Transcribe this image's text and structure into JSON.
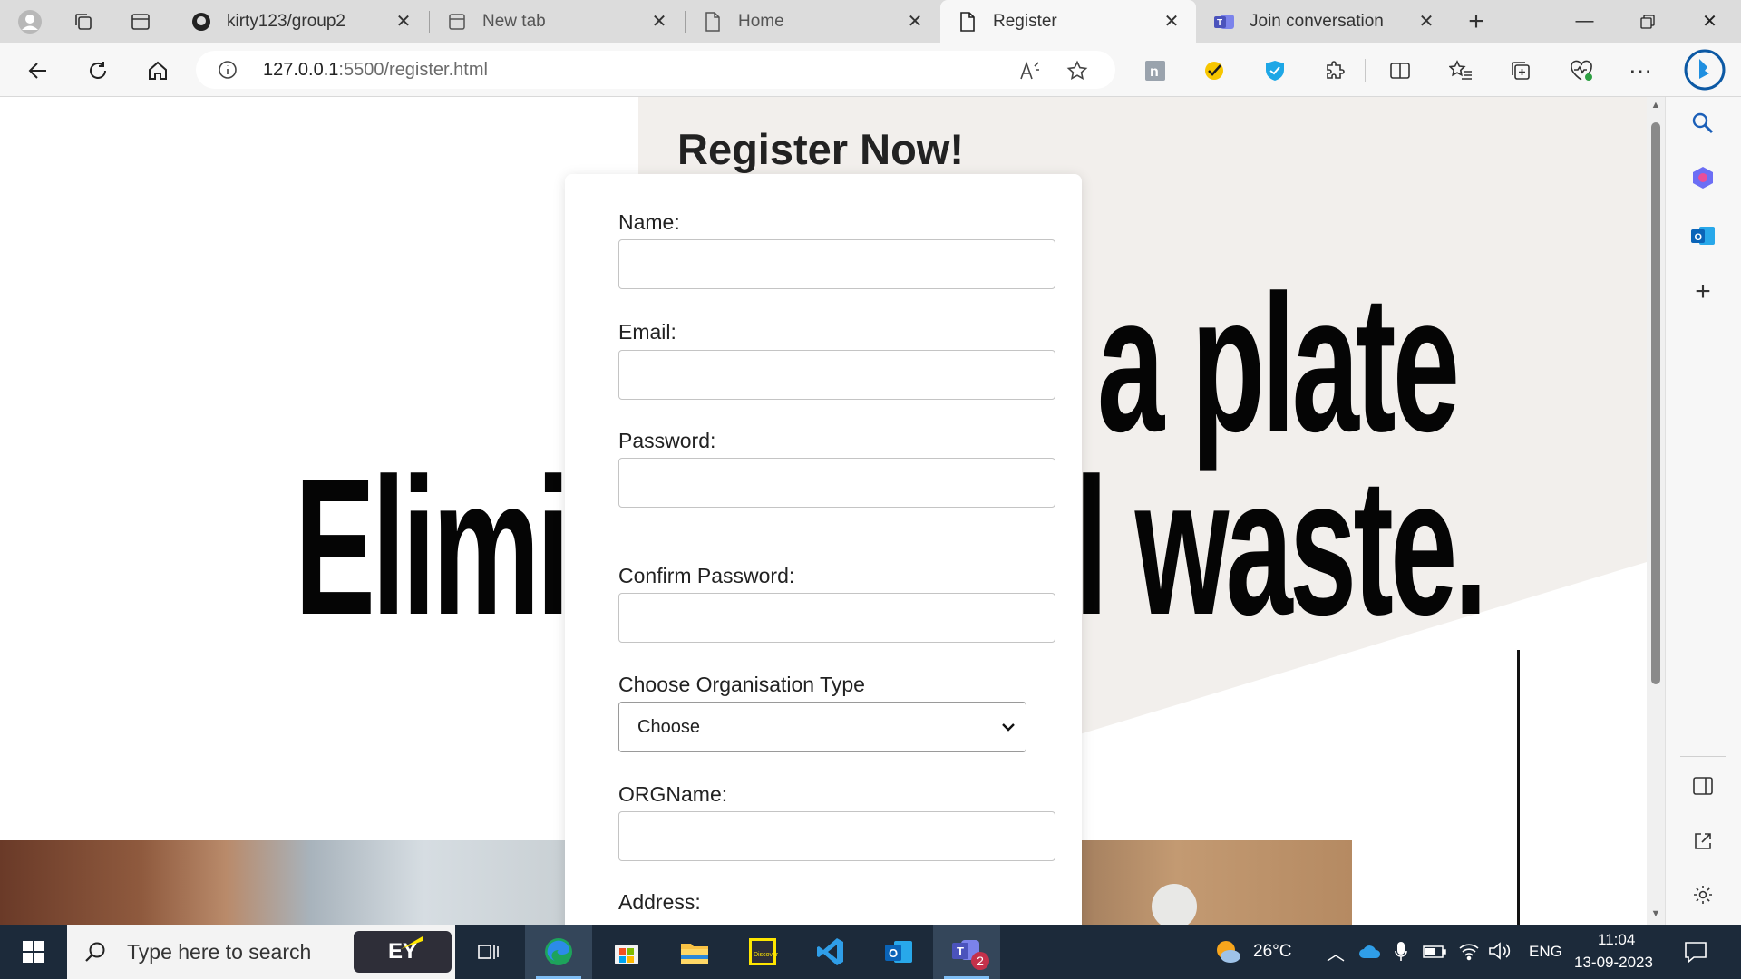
{
  "tabs": [
    {
      "title": "kirty123/group2",
      "icon": "github-icon"
    },
    {
      "title": "New tab",
      "icon": "new-tab-icon"
    },
    {
      "title": "Home",
      "icon": "page-icon"
    },
    {
      "title": "Register",
      "icon": "page-icon"
    },
    {
      "title": "Join conversation",
      "icon": "teams-icon"
    }
  ],
  "address": {
    "url_host": "127.0.0.1",
    "url_rest": ":5500/register.html"
  },
  "page": {
    "title": "Register Now!",
    "hero_line1": "a plate",
    "hero_line2_left": "Elimi",
    "hero_line2_right": "l waste."
  },
  "form": {
    "name_label": "Name:",
    "email_label": "Email:",
    "password_label": "Password:",
    "confirm_password_label": "Confirm Password:",
    "org_type_label": "Choose Organisation Type",
    "org_type_selected": "Choose",
    "org_name_label": "ORGName:",
    "address_label": "Address:"
  },
  "taskbar": {
    "search_placeholder": "Type here to search",
    "ey_label": "EY",
    "weather": "26°C",
    "language": "ENG",
    "time": "11:04",
    "date": "13-09-2023",
    "teams_badge": "2"
  },
  "colors": {
    "page_beige": "#f2efec",
    "edge_blue": "#0c59a4",
    "taskbar": "#1c2a3a"
  }
}
